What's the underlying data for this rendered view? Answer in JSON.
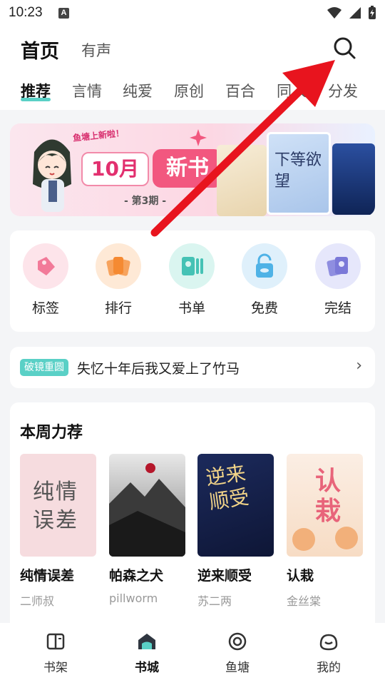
{
  "status_bar": {
    "time": "10:23",
    "notif_letter": "A"
  },
  "header": {
    "title": "首页",
    "subtitle": "有声"
  },
  "tabs": [
    "推荐",
    "言情",
    "纯爱",
    "原创",
    "百合",
    "同人",
    "分发"
  ],
  "banner": {
    "tag": "鱼塘上新啦！",
    "month": "10月",
    "headline": "新书",
    "issue": "- 第3期 -",
    "book_title_right": "下等欲望"
  },
  "quick_links": [
    {
      "label": "标签",
      "icon": "tag-icon"
    },
    {
      "label": "排行",
      "icon": "ranking-icon"
    },
    {
      "label": "书单",
      "icon": "booklist-icon"
    },
    {
      "label": "免费",
      "icon": "free-icon"
    },
    {
      "label": "完结",
      "icon": "finished-icon"
    }
  ],
  "notice": {
    "badge": "破镜重圆",
    "text": "失忆十年后我又爱上了竹马",
    "arrow": "›"
  },
  "weekly": {
    "title": "本周力荐",
    "books": [
      {
        "title": "纯情误差",
        "author": "二师叔",
        "cover_text": "纯情误差"
      },
      {
        "title": "帕森之犬",
        "author": "pillworm",
        "cover_text": ""
      },
      {
        "title": "逆来顺受",
        "author": "苏二两",
        "cover_text": "逆来顺受"
      },
      {
        "title": "认栽",
        "author": "金丝棠",
        "cover_text": "认栽"
      }
    ]
  },
  "bottom_nav": [
    {
      "label": "书架",
      "icon": "bookshelf-icon",
      "active": false
    },
    {
      "label": "书城",
      "icon": "bookstore-icon",
      "active": true
    },
    {
      "label": "鱼塘",
      "icon": "fishpond-icon",
      "active": false
    },
    {
      "label": "我的",
      "icon": "profile-icon",
      "active": false
    }
  ],
  "colors": {
    "accent": "#5ad0c6",
    "arrow": "#e8141e"
  }
}
